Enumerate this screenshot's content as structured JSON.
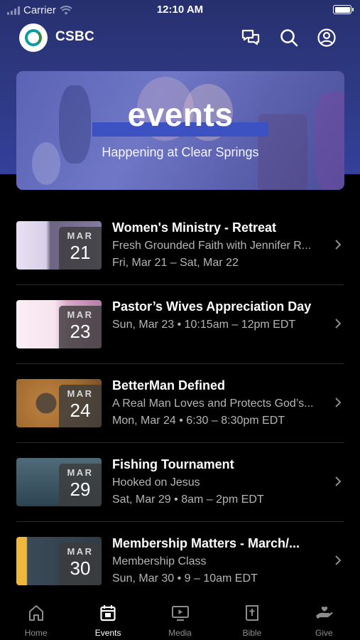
{
  "status_bar": {
    "carrier": "Carrier",
    "time": "12:10 AM"
  },
  "header": {
    "title": "CSBC",
    "icons": [
      "chat-icon",
      "search-icon",
      "profile-icon"
    ]
  },
  "banner": {
    "title": "events",
    "subtitle": "Happening at Clear Springs"
  },
  "events": [
    {
      "month": "MAR",
      "day": "21",
      "title": "Women's Ministry - Retreat",
      "line1": "Fresh Grounded Faith with Jennifer R...",
      "line2": "Fri, Mar 21 – Sat, Mar 22"
    },
    {
      "month": "MAR",
      "day": "23",
      "title": "Pastor’s Wives Appreciation Day",
      "line1": "Sun, Mar 23 • 10:15am – 12pm EDT",
      "line2": ""
    },
    {
      "month": "MAR",
      "day": "24",
      "title": "BetterMan Defined",
      "line1": "A Real Man Loves and Protects God’s...",
      "line2": "Mon, Mar 24 • 6:30 – 8:30pm EDT"
    },
    {
      "month": "MAR",
      "day": "29",
      "title": "Fishing Tournament",
      "line1": "Hooked on Jesus",
      "line2": "Sat, Mar 29 • 8am – 2pm EDT"
    },
    {
      "month": "MAR",
      "day": "30",
      "title": "Membership Matters - March/...",
      "line1": "Membership Class",
      "line2": "Sun, Mar 30 • 9 – 10am EDT"
    }
  ],
  "tabs": [
    {
      "label": "Home",
      "icon": "home-icon",
      "active": false
    },
    {
      "label": "Events",
      "icon": "calendar-icon",
      "active": true
    },
    {
      "label": "Media",
      "icon": "media-icon",
      "active": false
    },
    {
      "label": "Bible",
      "icon": "bible-icon",
      "active": false
    },
    {
      "label": "Give",
      "icon": "give-icon",
      "active": false
    }
  ],
  "colors": {
    "header_bg": "#2e3a85",
    "banner_bar": "#3c52c2",
    "active_tab": "#ffffff",
    "inactive_tab": "#8d8d8d"
  }
}
